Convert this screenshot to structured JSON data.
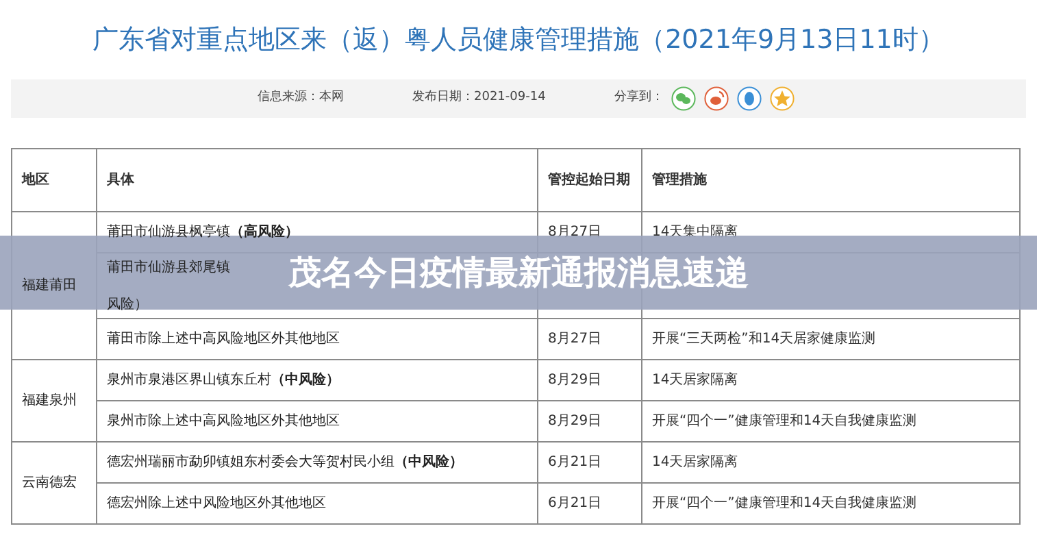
{
  "title": "广东省对重点地区来（返）粤人员健康管理措施（2021年9月13日11时）",
  "meta": {
    "source": "信息来源：本网",
    "date": "发布日期：2021-09-14",
    "share_label": "分享到："
  },
  "share_icons": [
    {
      "kind": "chat",
      "color": "#5cb85c"
    },
    {
      "kind": "weibo",
      "color": "#e0603a"
    },
    {
      "kind": "qq",
      "color": "#3a8fd6"
    },
    {
      "kind": "star",
      "color": "#f0b030"
    }
  ],
  "table": {
    "columns": [
      "地区",
      "具体",
      "管控起始日期",
      "管理措施"
    ],
    "groups": [
      {
        "region": "福建莆田",
        "rows": [
          {
            "specific": "莆田市仙游县枫亭镇**（高风险）**",
            "date": "8月27日",
            "measure": "14天集中隔离"
          },
          {
            "specific": "莆田市仙游县郊尾镇",
            "specific_tail": "风险）"
          },
          {
            "specific": "莆田市除上述中高风险地区外其他地区",
            "date": "8月27日",
            "measure": "开展“三天两检”和14天居家健康监测"
          }
        ]
      },
      {
        "region": "福建泉州",
        "rows": [
          {
            "specific": "泉州市泉港区界山镇东丘村**（中风险）**",
            "date": "8月29日",
            "measure": "14天居家隔离"
          },
          {
            "specific": "泉州市除上述中高风险地区外其他地区",
            "date": "8月29日",
            "measure": "开展“四个一”健康管理和14天自我健康监测"
          }
        ]
      },
      {
        "region": "云南德宏",
        "rows": [
          {
            "specific": "德宏州瑞丽市勐卯镇姐东村委会大等贺村民小组**（中风险）**",
            "date": "6月21日",
            "measure": "14天居家隔离"
          },
          {
            "specific": "德宏州除上述中风险地区外其他地区",
            "date": "6月21日",
            "measure": "开展“四个一”健康管理和14天自我健康监测"
          }
        ]
      }
    ]
  },
  "banner": {
    "text": "茂名今日疫情最新通报消息速递"
  }
}
